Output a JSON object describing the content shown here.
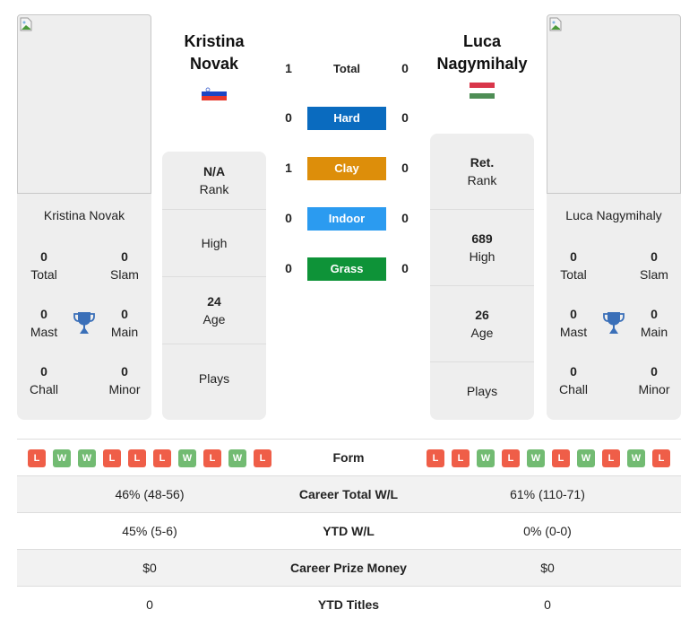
{
  "player1": {
    "name_header_line1": "Kristina",
    "name_header_line2": "Novak",
    "name": "Kristina Novak",
    "flag": "slovenia-flag",
    "titles": {
      "total": {
        "value": "0",
        "label": "Total"
      },
      "slam": {
        "value": "0",
        "label": "Slam"
      },
      "mast": {
        "value": "0",
        "label": "Mast"
      },
      "main": {
        "value": "0",
        "label": "Main"
      },
      "chall": {
        "value": "0",
        "label": "Chall"
      },
      "minor": {
        "value": "0",
        "label": "Minor"
      }
    },
    "info": {
      "rank": {
        "value": "N/A",
        "label": "Rank"
      },
      "high": {
        "value": "",
        "label": "High"
      },
      "age": {
        "value": "24",
        "label": "Age"
      },
      "plays": {
        "value": "",
        "label": "Plays"
      }
    },
    "form": [
      "L",
      "W",
      "W",
      "L",
      "L",
      "L",
      "W",
      "L",
      "W",
      "L"
    ]
  },
  "player2": {
    "name_header_line1": "Luca",
    "name_header_line2": "Nagymihaly",
    "name": "Luca Nagymihaly",
    "flag": "hungary-flag",
    "titles": {
      "total": {
        "value": "0",
        "label": "Total"
      },
      "slam": {
        "value": "0",
        "label": "Slam"
      },
      "mast": {
        "value": "0",
        "label": "Mast"
      },
      "main": {
        "value": "0",
        "label": "Main"
      },
      "chall": {
        "value": "0",
        "label": "Chall"
      },
      "minor": {
        "value": "0",
        "label": "Minor"
      }
    },
    "info": {
      "rank": {
        "value": "Ret.",
        "label": "Rank"
      },
      "high": {
        "value": "689",
        "label": "High"
      },
      "age": {
        "value": "26",
        "label": "Age"
      },
      "plays": {
        "value": "",
        "label": "Plays"
      }
    },
    "form": [
      "L",
      "L",
      "W",
      "L",
      "W",
      "L",
      "W",
      "L",
      "W",
      "L"
    ]
  },
  "h2h": [
    {
      "surface": "Total",
      "p1": "1",
      "p2": "0",
      "color": ""
    },
    {
      "surface": "Hard",
      "p1": "0",
      "p2": "0",
      "color": "#0a6bbf"
    },
    {
      "surface": "Clay",
      "p1": "1",
      "p2": "0",
      "color": "#dd8e0a"
    },
    {
      "surface": "Indoor",
      "p1": "0",
      "p2": "0",
      "color": "#2b9bf0"
    },
    {
      "surface": "Grass",
      "p1": "0",
      "p2": "0",
      "color": "#0e9338"
    }
  ],
  "form_label": "Form",
  "stats": [
    {
      "label": "Career Total W/L",
      "p1": "46% (48-56)",
      "p2": "61% (110-71)"
    },
    {
      "label": "YTD W/L",
      "p1": "45% (5-6)",
      "p2": "0% (0-0)"
    },
    {
      "label": "Career Prize Money",
      "p1": "$0",
      "p2": "$0"
    },
    {
      "label": "YTD Titles",
      "p1": "0",
      "p2": "0"
    }
  ],
  "colors": {
    "loss": "#ef5e48",
    "win": "#72bb72",
    "trophy": "#3a6fb8"
  }
}
